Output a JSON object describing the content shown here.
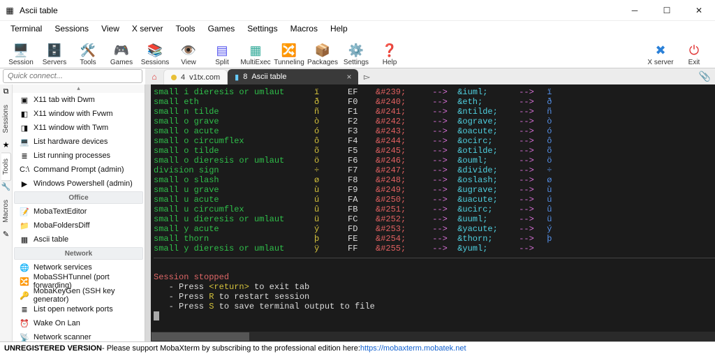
{
  "window": {
    "title": "Ascii table"
  },
  "menu": [
    "Terminal",
    "Sessions",
    "View",
    "X server",
    "Tools",
    "Games",
    "Settings",
    "Macros",
    "Help"
  ],
  "toolbar": [
    {
      "label": "Session",
      "icon": "🖥️",
      "c": "#3a7bd5"
    },
    {
      "label": "Servers",
      "icon": "🗄️",
      "c": "#c08030"
    },
    {
      "label": "Tools",
      "icon": "🛠️",
      "c": "#888"
    },
    {
      "label": "Games",
      "icon": "🎮",
      "c": "#888"
    },
    {
      "label": "Sessions",
      "icon": "📚",
      "c": "#c05050"
    },
    {
      "label": "View",
      "icon": "👁️",
      "c": "#3a9"
    },
    {
      "label": "Split",
      "icon": "▤",
      "c": "#55e"
    },
    {
      "label": "MultiExec",
      "icon": "▦",
      "c": "#3a9"
    },
    {
      "label": "Tunneling",
      "icon": "🔀",
      "c": "#c90"
    },
    {
      "label": "Packages",
      "icon": "📦",
      "c": "#b80"
    },
    {
      "label": "Settings",
      "icon": "⚙️",
      "c": "#55e"
    },
    {
      "label": "Help",
      "icon": "❓",
      "c": "#3a9"
    }
  ],
  "toolbar_right": [
    {
      "label": "X server",
      "icon": "✖",
      "c": "#2a80d8"
    },
    {
      "label": "Exit",
      "icon": "⏻",
      "c": "#e03030"
    }
  ],
  "quick_placeholder": "Quick connect...",
  "side_tabs": [
    "Sessions",
    "Tools",
    "Macros"
  ],
  "sidebar": {
    "initial": [
      {
        "icon": "▣",
        "label": "X11 tab with Dwm"
      },
      {
        "icon": "◧",
        "label": "X11 window with Fvwm"
      },
      {
        "icon": "◨",
        "label": "X11 window with Twm"
      },
      {
        "icon": "💻",
        "label": "List hardware devices"
      },
      {
        "icon": "≣",
        "label": "List running processes"
      },
      {
        "icon": "C:\\",
        "label": "Command Prompt (admin)"
      },
      {
        "icon": "▶",
        "label": "Windows Powershell (admin)"
      }
    ],
    "office_header": "Office",
    "office": [
      {
        "icon": "📝",
        "label": "MobaTextEditor"
      },
      {
        "icon": "📁",
        "label": "MobaFoldersDiff"
      },
      {
        "icon": "▦",
        "label": "Ascii table"
      }
    ],
    "network_header": "Network",
    "network": [
      {
        "icon": "🌐",
        "label": "Network services"
      },
      {
        "icon": "🔀",
        "label": "MobaSSHTunnel (port forwarding)"
      },
      {
        "icon": "🔑",
        "label": "MobaKeyGen (SSH key generator)"
      },
      {
        "icon": "≣",
        "label": "List open network ports"
      },
      {
        "icon": "⏰",
        "label": "Wake On Lan"
      },
      {
        "icon": "📡",
        "label": "Network scanner"
      }
    ]
  },
  "tabs": {
    "inactive": {
      "num": "4",
      "label": "v1tx.com"
    },
    "active": {
      "num": "8",
      "label": "Ascii table"
    }
  },
  "ascii_rows": [
    {
      "desc": "small i dieresis or umlaut",
      "glyph": "ï",
      "hex": "EF",
      "code": "&#239;",
      "ent": "&iuml;",
      "out": "ï"
    },
    {
      "desc": "small eth",
      "glyph": "ð",
      "hex": "F0",
      "code": "&#240;",
      "ent": "&eth;",
      "out": "ð"
    },
    {
      "desc": "small n tilde",
      "glyph": "ñ",
      "hex": "F1",
      "code": "&#241;",
      "ent": "&ntilde;",
      "out": "ñ"
    },
    {
      "desc": "small o grave",
      "glyph": "ò",
      "hex": "F2",
      "code": "&#242;",
      "ent": "&ograve;",
      "out": "ò"
    },
    {
      "desc": "small o acute",
      "glyph": "ó",
      "hex": "F3",
      "code": "&#243;",
      "ent": "&oacute;",
      "out": "ó"
    },
    {
      "desc": "small o circumflex",
      "glyph": "ô",
      "hex": "F4",
      "code": "&#244;",
      "ent": "&ocirc;",
      "out": "ô"
    },
    {
      "desc": "small o tilde",
      "glyph": "õ",
      "hex": "F5",
      "code": "&#245;",
      "ent": "&otilde;",
      "out": "õ"
    },
    {
      "desc": "small o dieresis or umlaut",
      "glyph": "ö",
      "hex": "F6",
      "code": "&#246;",
      "ent": "&ouml;",
      "out": "ö"
    },
    {
      "desc": "division sign",
      "glyph": "÷",
      "hex": "F7",
      "code": "&#247;",
      "ent": "&divide;",
      "out": "÷"
    },
    {
      "desc": "small o slash",
      "glyph": "ø",
      "hex": "F8",
      "code": "&#248;",
      "ent": "&oslash;",
      "out": "ø"
    },
    {
      "desc": "small u grave",
      "glyph": "ù",
      "hex": "F9",
      "code": "&#249;",
      "ent": "&ugrave;",
      "out": "ù"
    },
    {
      "desc": "small u acute",
      "glyph": "ú",
      "hex": "FA",
      "code": "&#250;",
      "ent": "&uacute;",
      "out": "ú"
    },
    {
      "desc": "small u circumflex",
      "glyph": "û",
      "hex": "FB",
      "code": "&#251;",
      "ent": "&ucirc;",
      "out": "û"
    },
    {
      "desc": "small u dieresis or umlaut",
      "glyph": "ü",
      "hex": "FC",
      "code": "&#252;",
      "ent": "&uuml;",
      "out": "ü"
    },
    {
      "desc": "small y acute",
      "glyph": "ý",
      "hex": "FD",
      "code": "&#253;",
      "ent": "&yacute;",
      "out": "ý"
    },
    {
      "desc": "small thorn",
      "glyph": "þ",
      "hex": "FE",
      "code": "&#254;",
      "ent": "&thorn;",
      "out": "þ"
    },
    {
      "desc": "small y dieresis or umlaut",
      "glyph": "ÿ",
      "hex": "FF",
      "code": "&#255;",
      "ent": "&yuml;",
      "out": ""
    }
  ],
  "session": {
    "stopped": "Session stopped",
    "l1a": "   - Press ",
    "l1b": "<return>",
    "l1c": " to exit tab",
    "l2a": "   - Press ",
    "l2b": "R",
    "l2c": " to restart session",
    "l3a": "   - Press ",
    "l3b": "S",
    "l3c": " to save terminal output to file"
  },
  "arrow": " -->",
  "status": {
    "unreg": "UNREGISTERED VERSION",
    "msg": " -  Please support MobaXterm by subscribing to the professional edition here:  ",
    "url": "https://mobaxterm.mobatek.net"
  }
}
